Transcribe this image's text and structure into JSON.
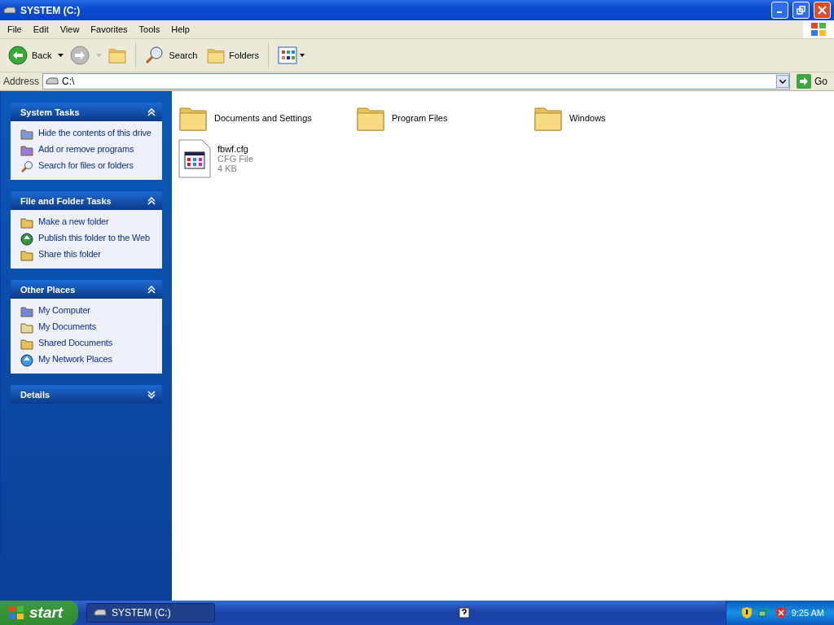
{
  "window": {
    "title": "SYSTEM (C:)"
  },
  "menu": [
    "File",
    "Edit",
    "View",
    "Favorites",
    "Tools",
    "Help"
  ],
  "toolbar": {
    "back": "Back",
    "search": "Search",
    "folders": "Folders"
  },
  "address": {
    "label": "Address",
    "value": "C:\\",
    "go": "Go"
  },
  "sidebar": {
    "sections": [
      {
        "title": "System Tasks",
        "expanded": true,
        "items": [
          {
            "label": "Hide the contents of this drive",
            "kind": "hide"
          },
          {
            "label": "Add or remove programs",
            "kind": "programs"
          },
          {
            "label": "Search for files or folders",
            "kind": "search"
          }
        ]
      },
      {
        "title": "File and Folder Tasks",
        "expanded": true,
        "items": [
          {
            "label": "Make a new folder",
            "kind": "newfolder"
          },
          {
            "label": "Publish this folder to the Web",
            "kind": "publish"
          },
          {
            "label": "Share this folder",
            "kind": "share"
          }
        ]
      },
      {
        "title": "Other Places",
        "expanded": true,
        "items": [
          {
            "label": "My Computer",
            "kind": "computer"
          },
          {
            "label": "My Documents",
            "kind": "documents"
          },
          {
            "label": "Shared Documents",
            "kind": "folder"
          },
          {
            "label": "My Network Places",
            "kind": "network"
          }
        ]
      },
      {
        "title": "Details",
        "expanded": false
      }
    ]
  },
  "files": [
    {
      "kind": "folder",
      "name": "Documents and Settings"
    },
    {
      "kind": "folder",
      "name": "Program Files"
    },
    {
      "kind": "folder",
      "name": "Windows"
    },
    {
      "kind": "file",
      "name": "fbwf.cfg",
      "type": "CFG File",
      "size": "4 KB"
    }
  ],
  "taskbar": {
    "start": "start",
    "tasks": [
      {
        "label": "SYSTEM (C:)",
        "selected": true
      }
    ],
    "clock": "9:25 AM"
  }
}
